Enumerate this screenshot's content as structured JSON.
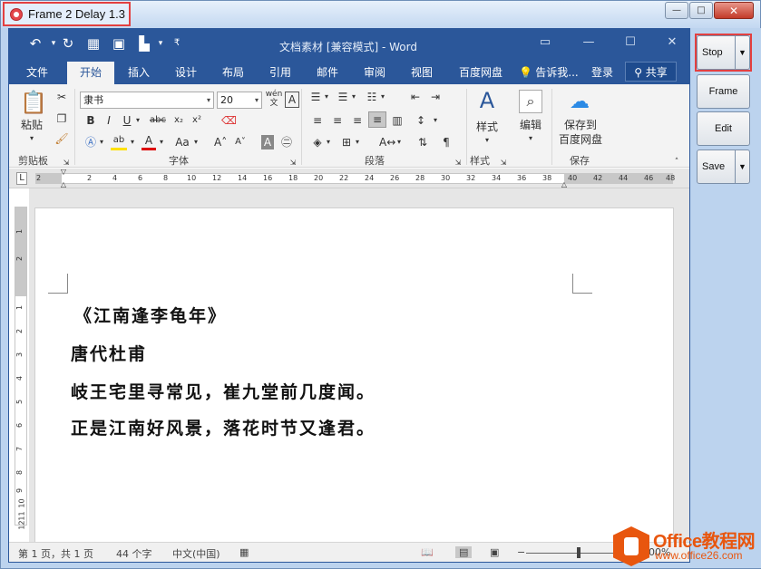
{
  "recorder": {
    "title": "Frame 2 Delay 1.3",
    "buttons": {
      "stop": "Stop",
      "frame": "Frame",
      "edit": "Edit",
      "save": "Save"
    }
  },
  "word": {
    "doc_title": "文档素材 [兼容模式] - Word",
    "tabs": [
      "文件",
      "开始",
      "插入",
      "设计",
      "布局",
      "引用",
      "邮件",
      "审阅",
      "视图",
      "百度网盘"
    ],
    "active_tab": "开始",
    "tell_me": "告诉我...",
    "login": "登录",
    "share": "共享",
    "ribbon": {
      "font_name": "隶书",
      "font_size": "20",
      "groups": [
        "剪贴板",
        "字体",
        "段落",
        "样式",
        "保存"
      ],
      "paste_label": "粘贴",
      "styles_label": "样式",
      "edit_label": "编辑",
      "save_to_label_1": "保存到",
      "save_to_label_2": "百度网盘"
    },
    "ruler_numbers": [
      "2",
      "2",
      "4",
      "6",
      "8",
      "10",
      "12",
      "14",
      "16",
      "18",
      "20",
      "22",
      "24",
      "26",
      "28",
      "30",
      "32",
      "34",
      "36",
      "38",
      "40",
      "42",
      "44",
      "46",
      "48"
    ],
    "vruler_numbers": [
      "1",
      "2",
      "1",
      "2",
      "3",
      "4",
      "5",
      "6",
      "7",
      "8",
      "9",
      "10",
      "11",
      "12"
    ],
    "document_lines": [
      "《江南逢李龟年》",
      "唐代杜甫",
      "岐王宅里寻常见，崔九堂前几度闻。",
      "正是江南好风景，落花时节又逢君。"
    ],
    "status": {
      "page": "第 1 页，共 1 页",
      "words": "44 个字",
      "lang": "中文(中国)",
      "zoom": "100%"
    }
  },
  "watermark": {
    "brand": "Office教程网",
    "url": "www.office26.com"
  }
}
